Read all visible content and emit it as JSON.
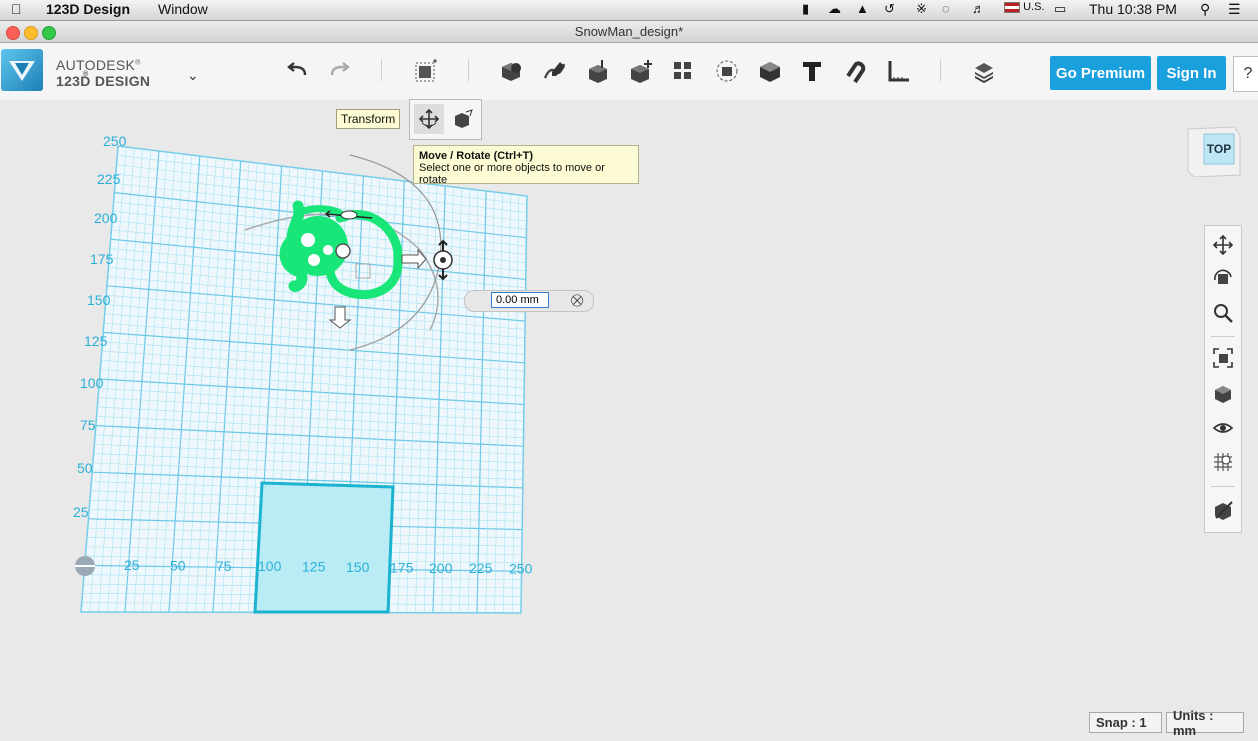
{
  "menubar": {
    "app_name": "123D Design",
    "menu_window": "Window",
    "input_source": "U.S.",
    "clock": "Thu 10:38 PM"
  },
  "window": {
    "title": "SnowMan_design*"
  },
  "brand": {
    "line1": "AUTODESK",
    "line2": "123D DESIGN",
    "registered1": "®",
    "registered2": "®"
  },
  "toolbar": {
    "go_premium": "Go Premium",
    "sign_in": "Sign In",
    "help": "?"
  },
  "tooltips": {
    "transform": "Transform",
    "move_title": "Move / Rotate (Ctrl+T)",
    "move_desc": "Select one or more objects to move or rotate"
  },
  "viewcube": {
    "face": "TOP"
  },
  "transform_input": {
    "value": "0.00 mm"
  },
  "grid": {
    "y_labels": [
      "250",
      "225",
      "200",
      "175",
      "150",
      "125",
      "100",
      "75",
      "50",
      "25"
    ],
    "x_labels": [
      "25",
      "50",
      "75",
      "100",
      "125",
      "150",
      "175",
      "200",
      "225",
      "250"
    ]
  },
  "statusbar": {
    "snap": "Snap : 1",
    "units": "Units : mm"
  },
  "colors": {
    "accent": "#1aa0dc",
    "grid": "#7fd1ec",
    "sketch": "#19e678",
    "selection": "#2ab0d8"
  }
}
